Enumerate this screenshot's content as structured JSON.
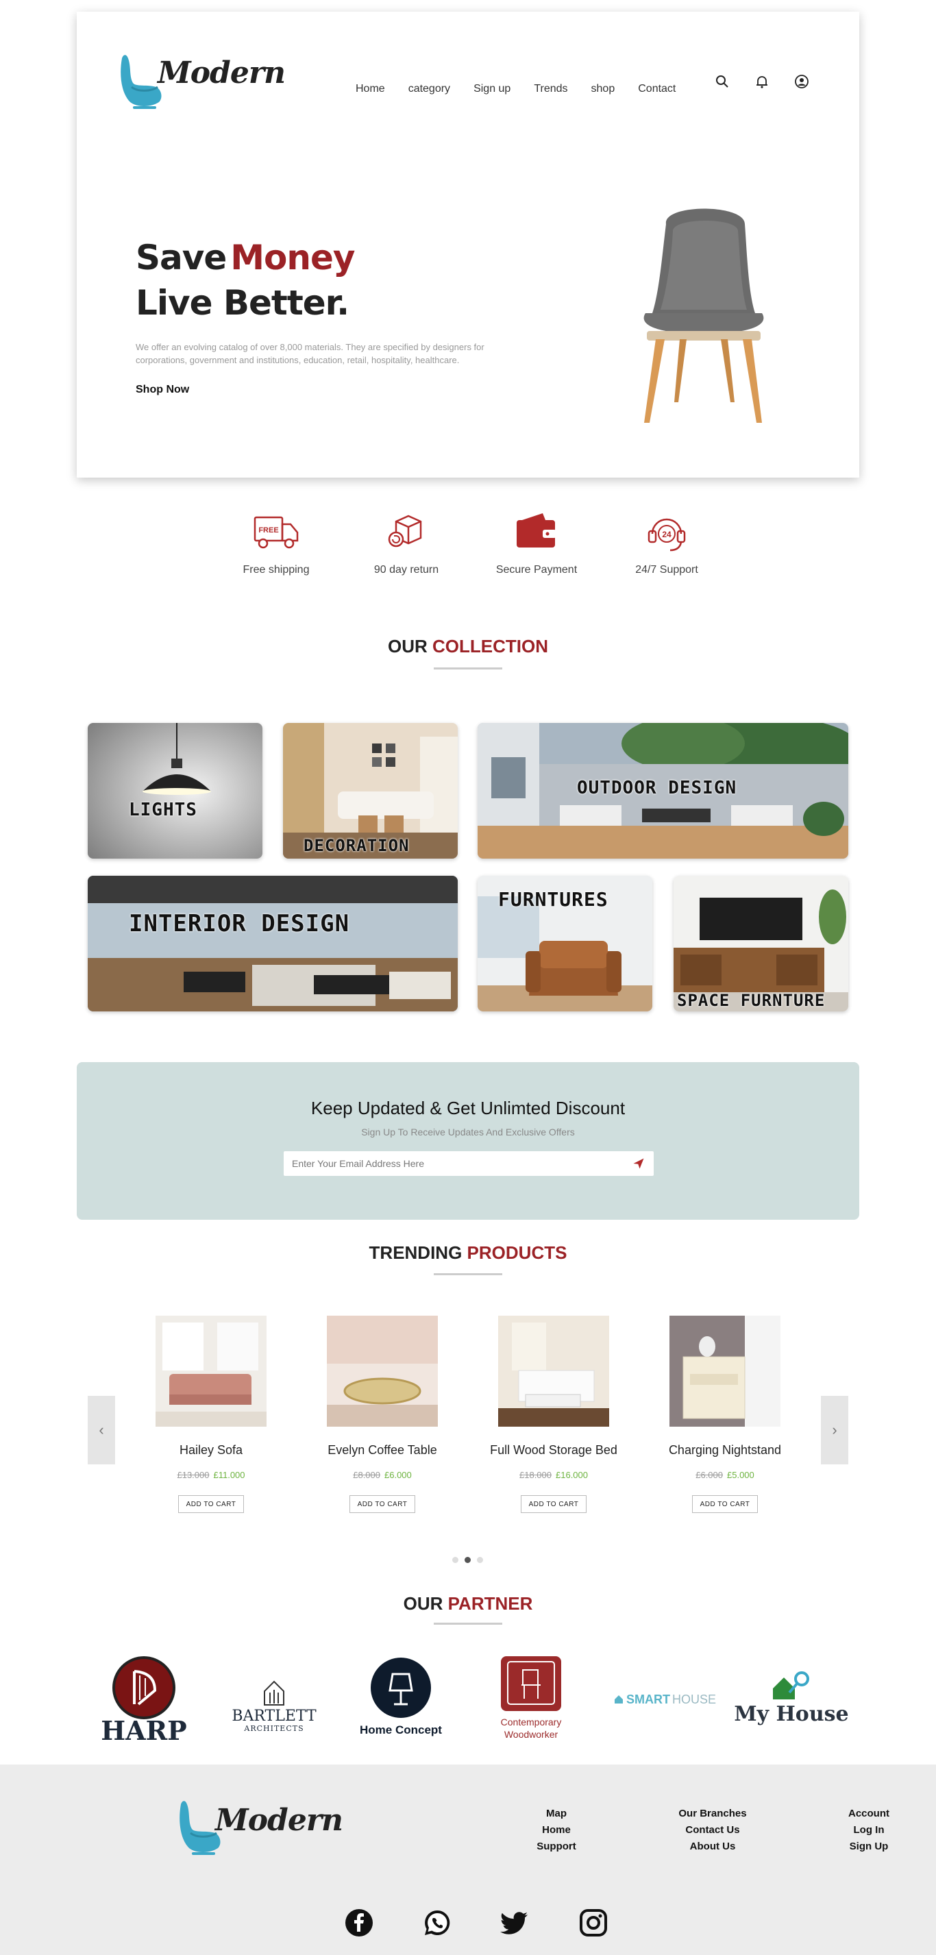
{
  "brand": {
    "name": "Modern",
    "accent": "#9b2226",
    "logo_color": "#3aa7c7"
  },
  "nav": {
    "items": [
      "Home",
      "category",
      "Sign up",
      "Trends",
      "shop",
      "Contact"
    ],
    "icons": [
      "search-icon",
      "bell-icon",
      "user-icon"
    ]
  },
  "hero": {
    "title_part1": "Save",
    "title_highlight": "Money",
    "title_line2": "Live Better.",
    "description": "We offer an evolving catalog of over 8,000 materials. They are specified by designers for corporations, government and institutions, education, retail, hospitality, healthcare.",
    "cta": "Shop Now"
  },
  "features": [
    {
      "label": "Free shipping",
      "icon": "free-shipping-truck-icon",
      "badge": "FREE"
    },
    {
      "label": "90 day return",
      "icon": "return-box-icon"
    },
    {
      "label": "Secure Payment",
      "icon": "wallet-icon"
    },
    {
      "label": "24/7 Support",
      "icon": "headset-icon",
      "badge": "24"
    }
  ],
  "collection": {
    "title": "OUR",
    "title_highlight": "COLLECTION",
    "tiles": [
      "LIGHTS",
      "DECORATION",
      "OUTDOOR DESIGN",
      "INTERIOR DESIGN",
      "FURNTURES",
      "SPACE FURNTURE"
    ]
  },
  "newsletter": {
    "title": "Keep Updated & Get Unlimted Discount",
    "subtitle": "Sign Up To Receive Updates And Exclusive Offers",
    "placeholder": "Enter Your Email Address Here"
  },
  "trending": {
    "title": "TRENDING",
    "title_highlight": "PRODUCTS",
    "add_label": "ADD TO CART",
    "products": [
      {
        "name": "Hailey Sofa",
        "old_price": "£13.000",
        "new_price": "£11.000"
      },
      {
        "name": "Evelyn Coffee Table",
        "old_price": "£8.000",
        "new_price": "£6.000"
      },
      {
        "name": "Full Wood Storage Bed",
        "old_price": "£18.000",
        "new_price": "£16.000"
      },
      {
        "name": "Charging Nightstand",
        "old_price": "£6.000",
        "new_price": "£5.000"
      }
    ],
    "prev": "‹",
    "next": "›"
  },
  "partners": {
    "title": "OUR",
    "title_highlight": "PARTNER",
    "logos": [
      {
        "name": "HARP"
      },
      {
        "name": "BARTLETT",
        "sub": "ARCHITECTS"
      },
      {
        "name": "Home Concept"
      },
      {
        "name": "Contemporary",
        "sub": "Woodworker"
      },
      {
        "name": "SMART",
        "sub": "HOUSE"
      },
      {
        "name": "My House"
      }
    ]
  },
  "footer": {
    "col1": [
      "Map",
      "Home",
      "Support"
    ],
    "col2": [
      "Our Branches",
      "Contact Us",
      "About Us"
    ],
    "col3": [
      "Account",
      "Log In",
      "Sign Up"
    ],
    "social": [
      "facebook-icon",
      "whatsapp-icon",
      "twitter-icon",
      "instagram-icon"
    ]
  }
}
